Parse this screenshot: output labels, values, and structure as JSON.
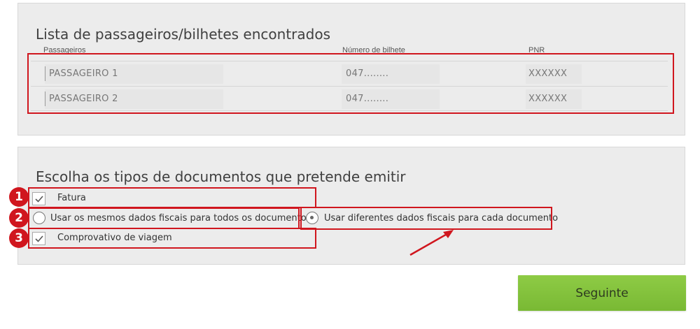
{
  "passengers_section": {
    "title": "Lista de passageiros/bilhetes encontrados",
    "columns": {
      "passenger": "Passageiros",
      "ticket": "Número de bilhete",
      "pnr": "PNR"
    },
    "rows": [
      {
        "name": "PASSAGEIRO 1",
        "ticket": "047........",
        "pnr": "XXXXXX"
      },
      {
        "name": "PASSAGEIRO 2",
        "ticket": "047........",
        "pnr": "XXXXXX"
      }
    ]
  },
  "documents_section": {
    "title": "Escolha os tipos de documentos que pretende emitir",
    "invoice": {
      "label": "Fatura",
      "checked": true
    },
    "same_fiscal_data": {
      "label": "Usar os mesmos dados fiscais para todos os documentos",
      "selected": false
    },
    "different_fiscal_data": {
      "label": "Usar diferentes dados fiscais para cada documento",
      "selected": true
    },
    "travel_receipt": {
      "label": "Comprovativo de viagem",
      "checked": true
    }
  },
  "annotations": {
    "step_badges": [
      "1",
      "2",
      "3"
    ],
    "highlight_color": "#d0161e"
  },
  "next_button": {
    "label": "Seguinte",
    "color": "#84c23d"
  }
}
